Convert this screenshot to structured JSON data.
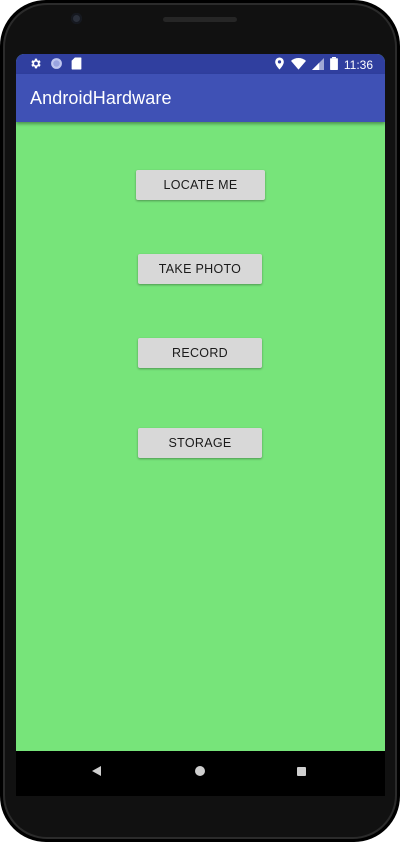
{
  "status_bar": {
    "time": "11:36",
    "left_icons": [
      "settings-icon",
      "circle-icon",
      "sd-card-icon"
    ],
    "right_icons": [
      "location-icon",
      "wifi-icon",
      "signal-icon",
      "battery-icon"
    ]
  },
  "app_bar": {
    "title": "AndroidHardware"
  },
  "buttons": {
    "locate_me": "LOCATE ME",
    "take_photo": "TAKE PHOTO",
    "record": "RECORD",
    "storage": "STORAGE"
  },
  "nav_bar": {
    "icons": [
      "back-icon",
      "home-icon",
      "recents-icon"
    ]
  },
  "colors": {
    "status_bar": "#303f9f",
    "app_bar": "#3f51b5",
    "background": "#77e47a",
    "button": "#d8d8d8"
  }
}
